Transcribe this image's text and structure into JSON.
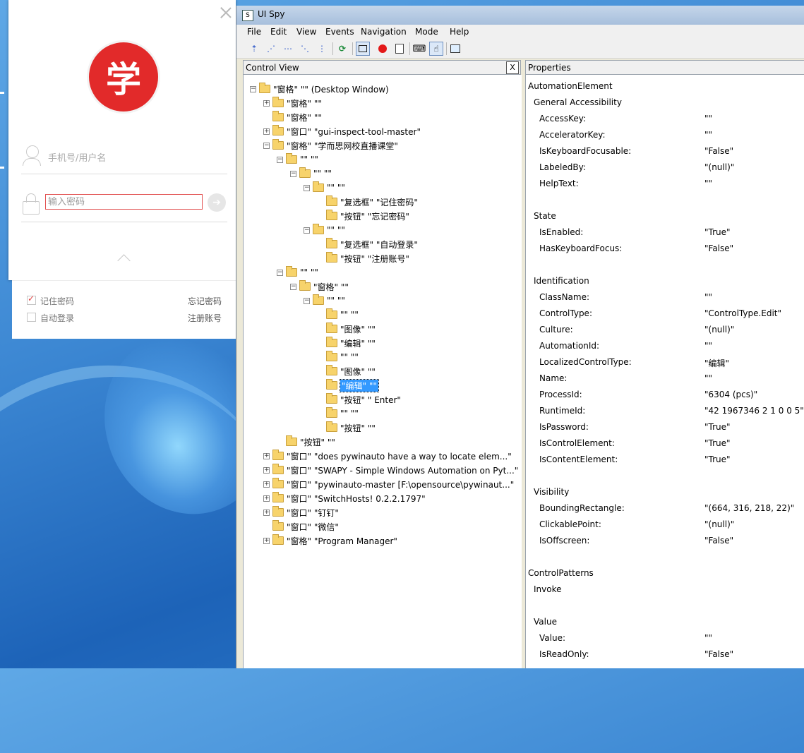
{
  "login": {
    "logo_char": "学",
    "username_placeholder": "手机号/用户名",
    "password_placeholder": "输入密码",
    "go_arrow": "➔",
    "remember_label": "记住密码",
    "remember_checked": true,
    "autologin_label": "自动登录",
    "autologin_checked": false,
    "forgot_label": "忘记密码",
    "register_label": "注册账号"
  },
  "spy": {
    "title": "UI Spy",
    "menu": [
      "File",
      "Edit",
      "View",
      "Events",
      "Navigation",
      "Mode",
      "Help"
    ],
    "toolbar_icons": [
      "nav-parent-icon",
      "nav-first-child-icon",
      "nav-prev-sibling-icon",
      "nav-next-sibling-icon",
      "nav-last-child-icon",
      "refresh-icon",
      "highlight-rect-icon",
      "record-icon",
      "properties-icon",
      "keyboard-icon",
      "hover-mode-icon",
      "screen-capture-icon"
    ],
    "control_view_title": "Control View",
    "control_view_close": "X",
    "properties_title": "Properties",
    "tree": [
      {
        "label": "\"窗格\" \"\" (Desktop Window)",
        "depth": 0,
        "expander": "-"
      },
      {
        "label": "\"窗格\" \"\"",
        "depth": 1,
        "expander": "+"
      },
      {
        "label": "\"窗格\" \"\"",
        "depth": 1,
        "expander": ""
      },
      {
        "label": "\"窗口\" \"gui-inspect-tool-master\"",
        "depth": 1,
        "expander": "+"
      },
      {
        "label": "\"窗格\" \"学而思网校直播课堂\"",
        "depth": 1,
        "expander": "-"
      },
      {
        "label": "\"\" \"\"",
        "depth": 2,
        "expander": "-"
      },
      {
        "label": "\"\" \"\"",
        "depth": 3,
        "expander": "-"
      },
      {
        "label": "\"\" \"\"",
        "depth": 4,
        "expander": "-"
      },
      {
        "label": "\"复选框\" \"记住密码\"",
        "depth": 5,
        "expander": ""
      },
      {
        "label": "\"按钮\" \"忘记密码\"",
        "depth": 5,
        "expander": ""
      },
      {
        "label": "\"\" \"\"",
        "depth": 4,
        "expander": "-"
      },
      {
        "label": "\"复选框\" \"自动登录\"",
        "depth": 5,
        "expander": ""
      },
      {
        "label": "\"按钮\" \"注册账号\"",
        "depth": 5,
        "expander": ""
      },
      {
        "label": "\"\" \"\"",
        "depth": 2,
        "expander": "-"
      },
      {
        "label": "\"窗格\" \"\"",
        "depth": 3,
        "expander": "-"
      },
      {
        "label": "\"\" \"\"",
        "depth": 4,
        "expander": "-"
      },
      {
        "label": "\"\" \"\"",
        "depth": 5,
        "expander": ""
      },
      {
        "label": "\"图像\" \"\"",
        "depth": 5,
        "expander": ""
      },
      {
        "label": "\"编辑\" \"\"",
        "depth": 5,
        "expander": ""
      },
      {
        "label": "\"\" \"\"",
        "depth": 5,
        "expander": ""
      },
      {
        "label": "\"图像\" \"\"",
        "depth": 5,
        "expander": ""
      },
      {
        "label": "\"编辑\" \"\"",
        "depth": 5,
        "expander": "",
        "selected": true
      },
      {
        "label": "\"按钮\" \" Enter\"",
        "depth": 5,
        "expander": ""
      },
      {
        "label": "\"\" \"\"",
        "depth": 5,
        "expander": ""
      },
      {
        "label": "\"按钮\" \"\"",
        "depth": 5,
        "expander": ""
      },
      {
        "label": "\"按钮\" \"\"",
        "depth": 2,
        "expander": ""
      },
      {
        "label": "\"窗口\" \"does pywinauto have a way to locate elem...\"",
        "depth": 1,
        "expander": "+"
      },
      {
        "label": "\"窗口\" \"SWAPY - Simple Windows Automation on Pyt...\"",
        "depth": 1,
        "expander": "+"
      },
      {
        "label": "\"窗口\" \"pywinauto-master [F:\\opensource\\pywinaut...\"",
        "depth": 1,
        "expander": "+"
      },
      {
        "label": "\"窗口\" \"SwitchHosts! 0.2.2.1797\"",
        "depth": 1,
        "expander": "+"
      },
      {
        "label": "\"窗口\" \"钉钉\"",
        "depth": 1,
        "expander": "+"
      },
      {
        "label": "\"窗口\" \"微信\"",
        "depth": 1,
        "expander": ""
      },
      {
        "label": "\"窗格\" \"Program Manager\"",
        "depth": 1,
        "expander": "+"
      }
    ],
    "properties": [
      {
        "kind": "group",
        "label": "AutomationElement"
      },
      {
        "kind": "section",
        "label": "General Accessibility"
      },
      {
        "kind": "prop",
        "name": "AccessKey:",
        "value": "\"\""
      },
      {
        "kind": "prop",
        "name": "AcceleratorKey:",
        "value": "\"\""
      },
      {
        "kind": "prop",
        "name": "IsKeyboardFocusable:",
        "value": "\"False\""
      },
      {
        "kind": "prop",
        "name": "LabeledBy:",
        "value": "\"(null)\""
      },
      {
        "kind": "prop",
        "name": "HelpText:",
        "value": "\"\""
      },
      {
        "kind": "blank"
      },
      {
        "kind": "section",
        "label": "State"
      },
      {
        "kind": "prop",
        "name": "IsEnabled:",
        "value": "\"True\""
      },
      {
        "kind": "prop",
        "name": "HasKeyboardFocus:",
        "value": "\"False\""
      },
      {
        "kind": "blank"
      },
      {
        "kind": "section",
        "label": "Identification"
      },
      {
        "kind": "prop",
        "name": "ClassName:",
        "value": "\"\""
      },
      {
        "kind": "prop",
        "name": "ControlType:",
        "value": "\"ControlType.Edit\""
      },
      {
        "kind": "prop",
        "name": "Culture:",
        "value": "\"(null)\""
      },
      {
        "kind": "prop",
        "name": "AutomationId:",
        "value": "\"\""
      },
      {
        "kind": "prop",
        "name": "LocalizedControlType:",
        "value": "\"编辑\""
      },
      {
        "kind": "prop",
        "name": "Name:",
        "value": "\"\""
      },
      {
        "kind": "prop",
        "name": "ProcessId:",
        "value": "\"6304 (pcs)\""
      },
      {
        "kind": "prop",
        "name": "RuntimeId:",
        "value": "\"42 1967346 2 1 0 0 5\""
      },
      {
        "kind": "prop",
        "name": "IsPassword:",
        "value": "\"True\""
      },
      {
        "kind": "prop",
        "name": "IsControlElement:",
        "value": "\"True\""
      },
      {
        "kind": "prop",
        "name": "IsContentElement:",
        "value": "\"True\""
      },
      {
        "kind": "blank"
      },
      {
        "kind": "section",
        "label": "Visibility"
      },
      {
        "kind": "prop",
        "name": "BoundingRectangle:",
        "value": "\"(664, 316, 218, 22)\""
      },
      {
        "kind": "prop",
        "name": "ClickablePoint:",
        "value": "\"(null)\""
      },
      {
        "kind": "prop",
        "name": "IsOffscreen:",
        "value": "\"False\""
      },
      {
        "kind": "blank"
      },
      {
        "kind": "group",
        "label": "ControlPatterns"
      },
      {
        "kind": "section",
        "label": "Invoke"
      },
      {
        "kind": "blank"
      },
      {
        "kind": "section",
        "label": "Value"
      },
      {
        "kind": "prop",
        "name": "Value:",
        "value": "\"\""
      },
      {
        "kind": "prop",
        "name": "IsReadOnly:",
        "value": "\"False\""
      }
    ]
  }
}
